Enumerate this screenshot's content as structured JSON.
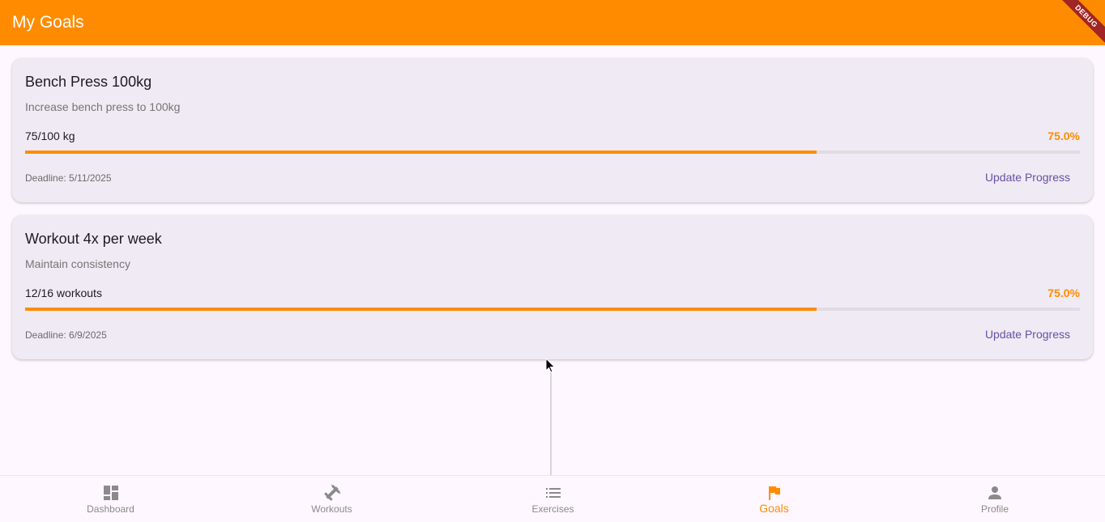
{
  "app_bar": {
    "title": "My Goals",
    "debug_banner": "DEBUG"
  },
  "goals": [
    {
      "title": "Bench Press 100kg",
      "description": "Increase bench press to 100kg",
      "progress_text": "75/100 kg",
      "percent_text": "75.0%",
      "progress": 0.75,
      "deadline": "Deadline: 5/11/2025",
      "action_label": "Update Progress"
    },
    {
      "title": "Workout 4x per week",
      "description": "Maintain consistency",
      "progress_text": "12/16 workouts",
      "percent_text": "75.0%",
      "progress": 0.75,
      "deadline": "Deadline: 6/9/2025",
      "action_label": "Update Progress"
    }
  ],
  "bottom_nav": {
    "items": [
      {
        "label": "Dashboard",
        "icon": "dashboard-icon",
        "active": false
      },
      {
        "label": "Workouts",
        "icon": "dumbbell-icon",
        "active": false
      },
      {
        "label": "Exercises",
        "icon": "list-icon",
        "active": false
      },
      {
        "label": "Goals",
        "icon": "flag-icon",
        "active": true
      },
      {
        "label": "Profile",
        "icon": "person-icon",
        "active": false
      }
    ]
  },
  "colors": {
    "primary": "#ff8c00",
    "action_text": "#6750a4",
    "card_bg": "#f0eaf4",
    "page_bg": "#fef7ff",
    "inactive_nav": "#8a8a8a"
  }
}
